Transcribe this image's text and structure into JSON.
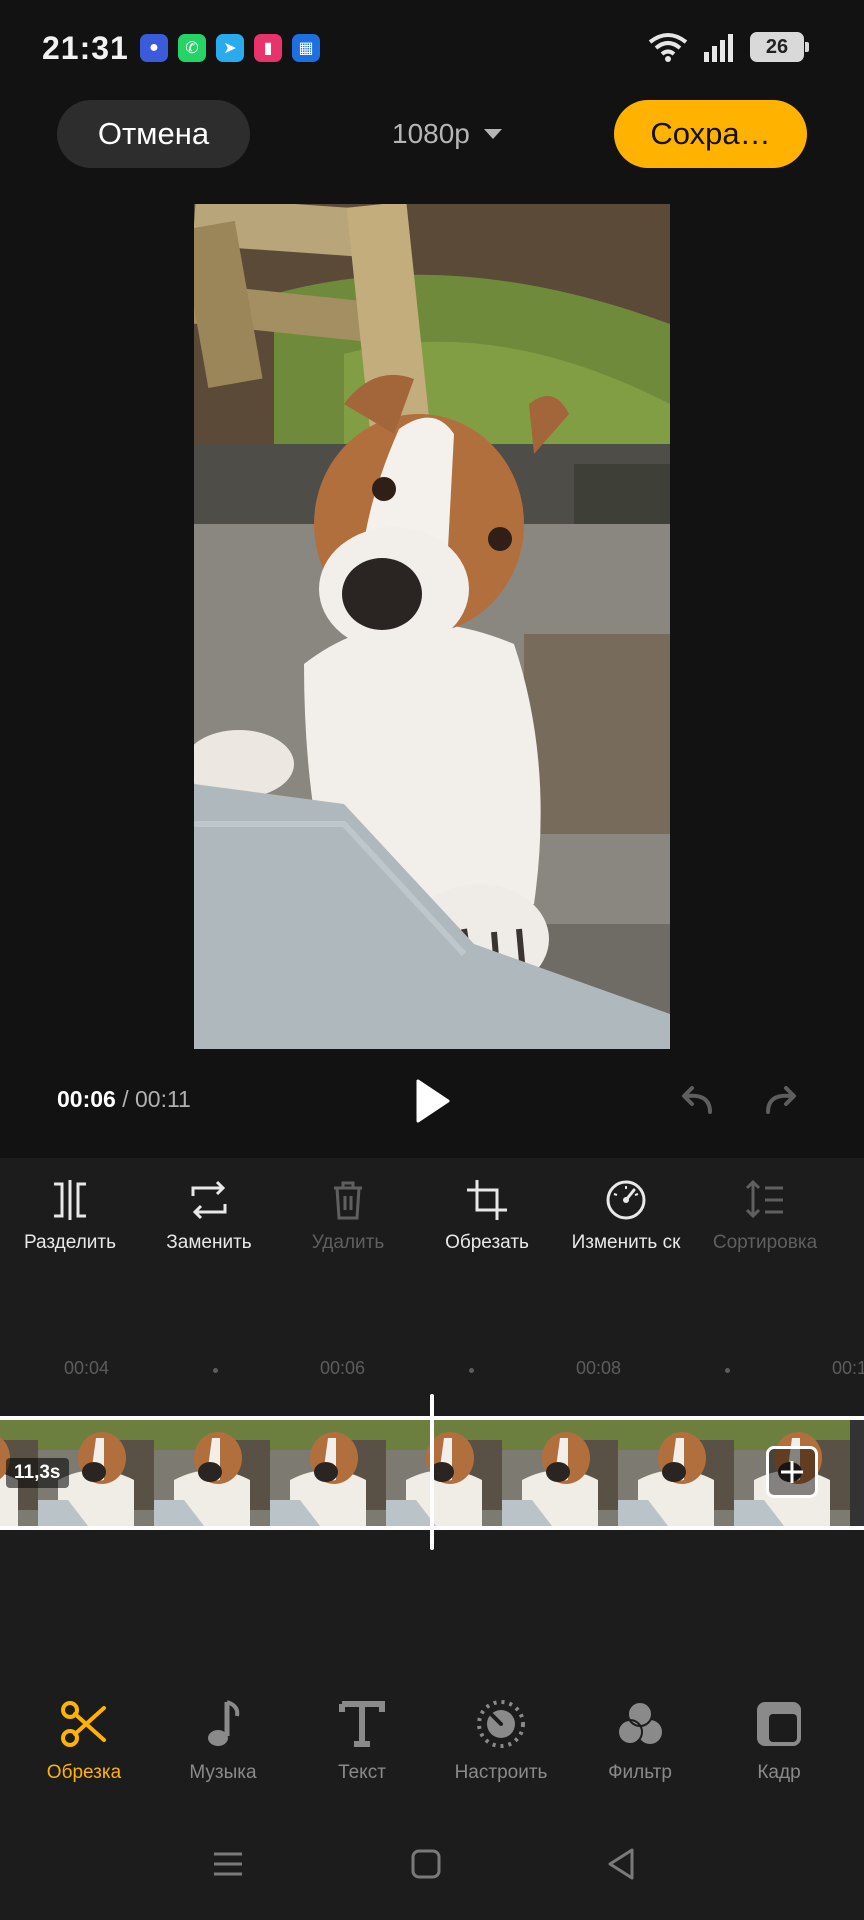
{
  "status_bar": {
    "time": "21:31",
    "battery": "26",
    "apps": [
      "chat-app-icon",
      "whatsapp-icon",
      "telegram-icon",
      "video-app-icon",
      "maps-app-icon"
    ]
  },
  "top_bar": {
    "cancel_label": "Отмена",
    "resolution": "1080p",
    "save_label": "Сохра…"
  },
  "playback": {
    "current_time": "00:06",
    "separator": "/",
    "total_time": "00:11"
  },
  "toolbar": {
    "items": [
      {
        "label": "Разделить",
        "icon": "split-icon",
        "enabled": true
      },
      {
        "label": "Заменить",
        "icon": "replace-icon",
        "enabled": true
      },
      {
        "label": "Удалить",
        "icon": "trash-icon",
        "enabled": false
      },
      {
        "label": "Обрезать",
        "icon": "crop-icon",
        "enabled": true
      },
      {
        "label": "Изменить ск",
        "icon": "speed-icon",
        "enabled": true
      },
      {
        "label": "Сортировка",
        "icon": "sort-icon",
        "enabled": false
      }
    ]
  },
  "timeline": {
    "ticks": [
      "00:04",
      "00:06",
      "00:08",
      "00:1"
    ],
    "clip_duration": "11,3s"
  },
  "bottom_nav": {
    "items": [
      {
        "label": "Обрезка",
        "icon": "scissors-icon",
        "active": true
      },
      {
        "label": "Музыка",
        "icon": "music-note-icon",
        "active": false
      },
      {
        "label": "Текст",
        "icon": "text-icon",
        "active": false
      },
      {
        "label": "Настроить",
        "icon": "adjust-dial-icon",
        "active": false
      },
      {
        "label": "Фильтр",
        "icon": "filter-icon",
        "active": false
      },
      {
        "label": "Кадр",
        "icon": "frame-icon",
        "active": false
      }
    ]
  },
  "colors": {
    "accent": "#ffb300",
    "background": "#121212",
    "panel": "#1c1c1c"
  }
}
